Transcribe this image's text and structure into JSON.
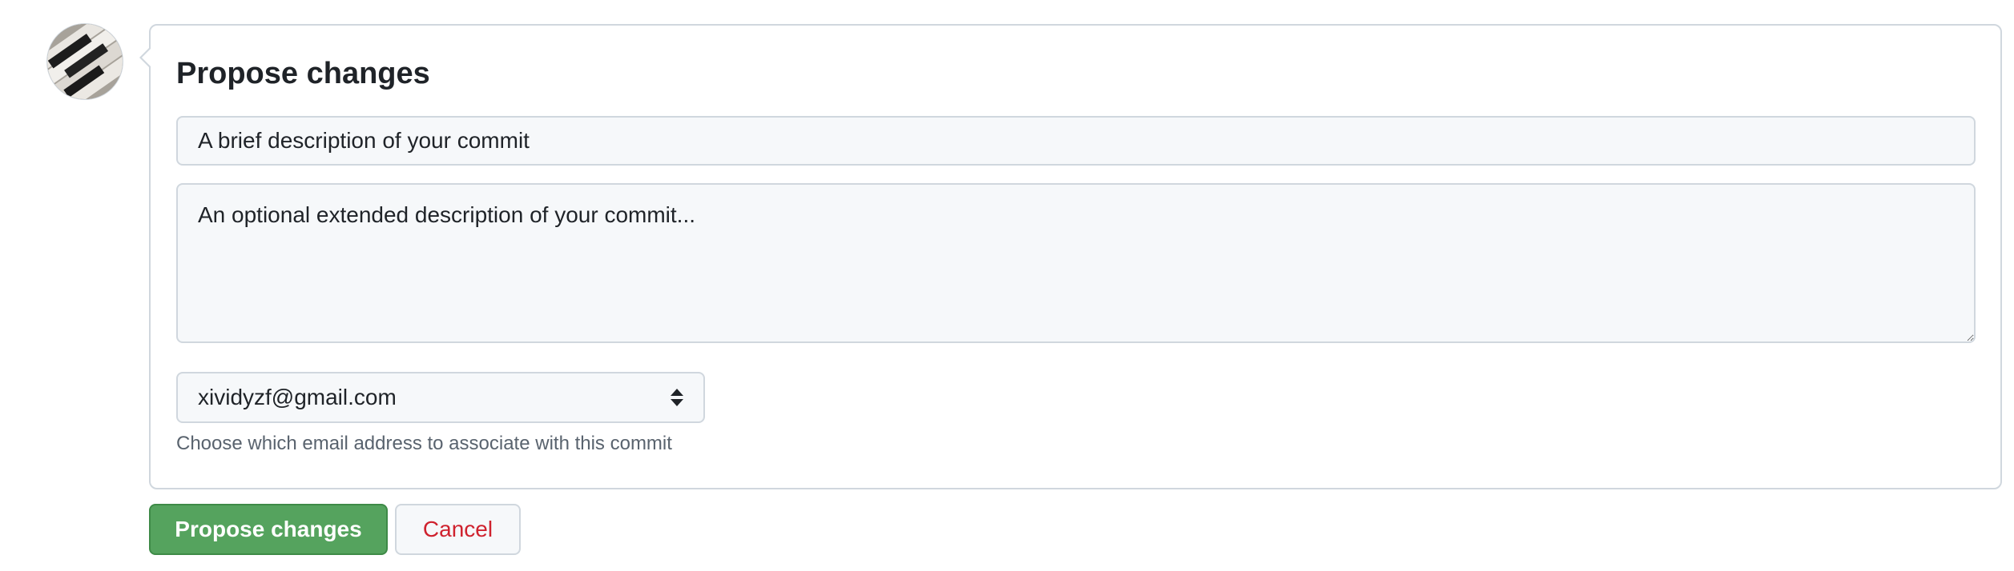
{
  "user": {
    "avatar_icon": "piano-keys-avatar-icon"
  },
  "commit_form": {
    "title": "Propose changes",
    "summary_placeholder": "A brief description of your commit",
    "description_placeholder": "An optional extended description of your commit...",
    "email_select": {
      "selected": "xividyzf@gmail.com",
      "icon": "select-arrows-icon"
    },
    "email_hint": "Choose which email address to associate with this commit"
  },
  "actions": {
    "propose_label": "Propose changes",
    "cancel_label": "Cancel"
  },
  "colors": {
    "primary_button": "#55a35e",
    "cancel_text": "#cf222e",
    "border": "#d0d7de",
    "input_bg": "#f6f8fa"
  }
}
